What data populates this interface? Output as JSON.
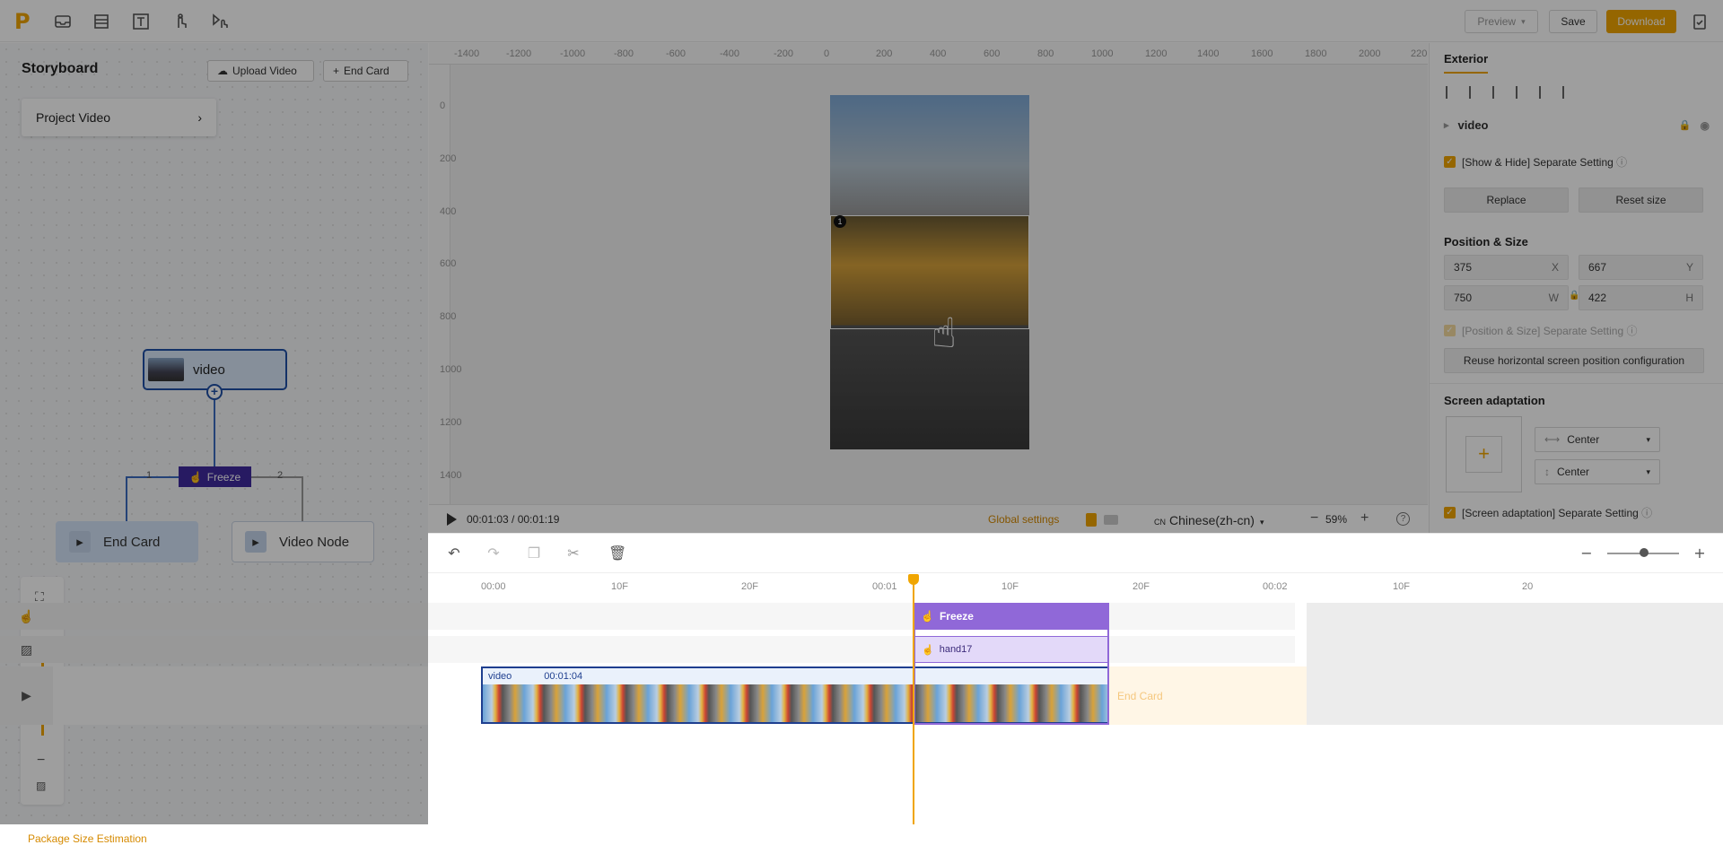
{
  "topbar": {
    "logo": "P",
    "tools": [
      "inbox-icon",
      "layers-icon",
      "text-icon",
      "gesture-icon",
      "interaction-icon"
    ],
    "preview_label": "Preview",
    "save_label": "Save",
    "download_label": "Download"
  },
  "storyboard": {
    "title": "Storyboard",
    "upload_label": "Upload Video",
    "endcard_label": "End Card",
    "project_item": "Project Video",
    "node_video": "video",
    "node_freeze": "Freeze",
    "node_endcard": "End Card",
    "node_videonode": "Video Node",
    "branch_1": "1",
    "branch_2": "2",
    "package_label": "Package Size Estimation"
  },
  "canvas": {
    "ruler_x": [
      "-1400",
      "-1200",
      "-1000",
      "-800",
      "-600",
      "-400",
      "-200",
      "0",
      "200",
      "400",
      "600",
      "800",
      "1000",
      "1200",
      "1400",
      "1600",
      "1800",
      "2000",
      "220"
    ],
    "ruler_y": [
      "0",
      "200",
      "400",
      "600",
      "800",
      "1000",
      "1200",
      "1400"
    ],
    "badge": "1",
    "time": "00:01:03 / 00:01:19",
    "global_settings": "Global settings",
    "lang_prefix": "CN",
    "language": "Chinese(zh-cn)",
    "zoom": "59%"
  },
  "exterior": {
    "tab": "Exterior",
    "layer_name": "video",
    "show_hide_label": "[Show & Hide]",
    "separate_setting": "Separate Setting",
    "replace_label": "Replace",
    "reset_size_label": "Reset size",
    "position_title": "Position & Size",
    "x": "375",
    "x_unit": "X",
    "y": "667",
    "y_unit": "Y",
    "w": "750",
    "w_unit": "W",
    "h": "422",
    "h_unit": "H",
    "pos_size_label": "[Position & Size]",
    "reuse_label": "Reuse horizontal screen position configuration",
    "screen_adapt_title": "Screen adaptation",
    "h_align": "Center",
    "v_align": "Center",
    "screen_adapt_label": "[Screen adaptation]"
  },
  "timeline": {
    "ticks": [
      "00:00",
      "10F",
      "20F",
      "00:01",
      "10F",
      "20F",
      "00:02",
      "10F",
      "20"
    ],
    "freeze_label": "Freeze",
    "hand_label": "hand17",
    "video_label": "video",
    "video_duration": "00:01:04",
    "endcard_label": "End Card"
  },
  "colors": {
    "accent": "#f0a500",
    "freeze": "#9068d8",
    "node_border": "#1f4fa6"
  }
}
